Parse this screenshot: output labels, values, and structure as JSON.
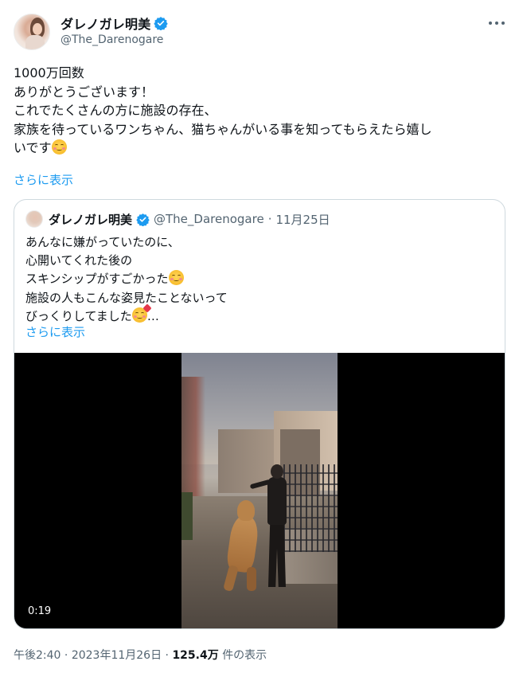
{
  "author": {
    "display_name": "ダレノガレ明美",
    "handle": "@The_Darenogare"
  },
  "tweet": {
    "lines": [
      "1000万回数",
      "ありがとうございます！",
      "これでたくさんの方に施設の存在、",
      "家族を待っているワンちゃん、猫ちゃんがいる事を知ってもらえたら嬉し",
      "いです"
    ],
    "show_more": "さらに表示"
  },
  "quote": {
    "display_name": "ダレノガレ明美",
    "handle": "@The_Darenogare",
    "separator": "·",
    "date": "11月25日",
    "lines": [
      "あんなに嫌がっていたのに、",
      "心開いてくれた後の",
      "スキンシップがすごかった",
      "施設の人もこんな姿見たことないって",
      "びっくりしてました"
    ],
    "ellipsis": "…",
    "show_more": "さらに表示",
    "video": {
      "duration": "0:19"
    }
  },
  "meta": {
    "time": "午後2:40",
    "separator": "·",
    "date": "2023年11月26日",
    "views_count": "125.4万",
    "views_label": "件の表示"
  },
  "colors": {
    "accent": "#1d9bf0",
    "verified": "#1d9bf0",
    "secondary_text": "#536471"
  },
  "icons": [
    "verified-badge-icon",
    "more-options-icon",
    "smiling-face-emoji",
    "smiling-face-with-hearts-emoji"
  ]
}
